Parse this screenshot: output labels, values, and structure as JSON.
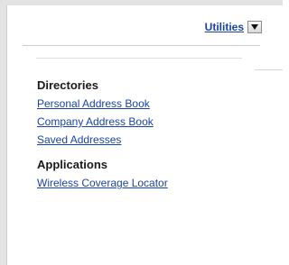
{
  "utilities": {
    "label": "Utilities",
    "dropdown_icon": "caret-down-icon"
  },
  "menu": {
    "sections": [
      {
        "heading": "Directories",
        "links": [
          "Personal Address Book",
          "Company Address Book",
          "Saved Addresses"
        ]
      },
      {
        "heading": "Applications",
        "links": [
          "Wireless Coverage Locator"
        ]
      }
    ]
  },
  "colors": {
    "link": "#1a43a8",
    "heading": "#1a1a1a",
    "frame": "#e3e3e3"
  }
}
